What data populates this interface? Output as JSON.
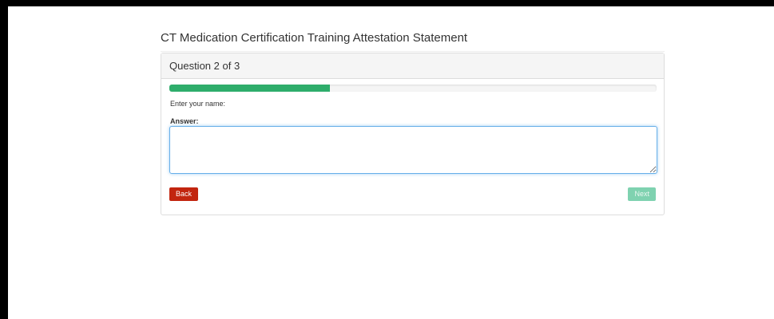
{
  "page": {
    "title": "CT Medication Certification Training Attestation Statement"
  },
  "question": {
    "heading": "Question 2 of 3",
    "progress_percent": 33,
    "prompt": "Enter your name:",
    "answer_label": "Answer:",
    "answer_value": ""
  },
  "buttons": {
    "back_label": "Back",
    "next_label": "Next"
  },
  "colors": {
    "progress": "#2ead6b",
    "back_button": "#c2250f",
    "next_button": "#7fd2b0"
  }
}
